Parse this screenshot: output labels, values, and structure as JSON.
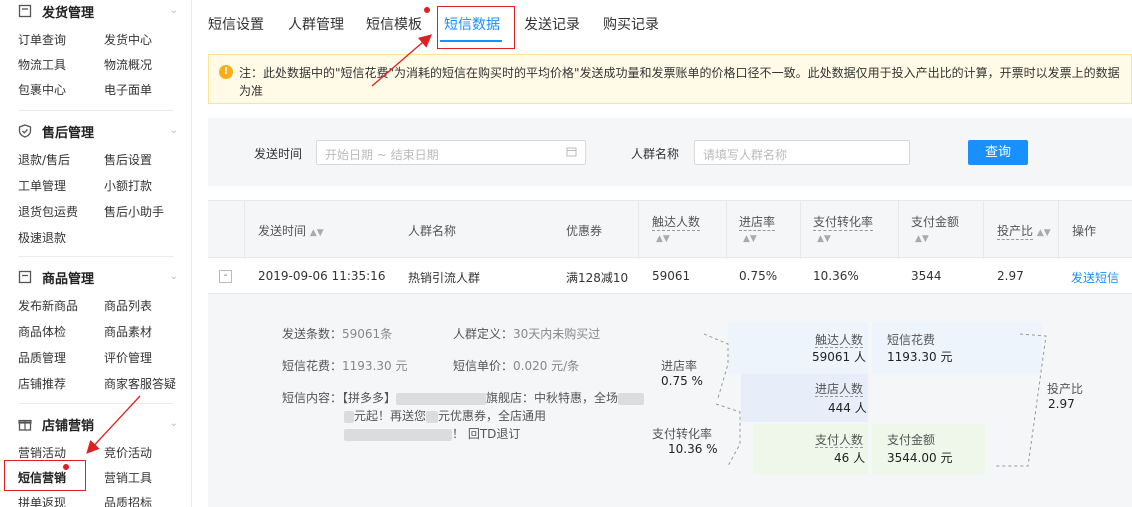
{
  "sidebar": {
    "sections": [
      {
        "title": "发货管理",
        "icon": "shipping-box-icon",
        "items": [
          "订单查询",
          "发货中心",
          "物流工具",
          "物流概况",
          "包裹中心",
          "电子面单"
        ]
      },
      {
        "title": "售后管理",
        "icon": "shield-icon",
        "items": [
          "退款/售后",
          "售后设置",
          "工单管理",
          "小额打款",
          "退货包运费",
          "售后小助手",
          "极速退款"
        ]
      },
      {
        "title": "商品管理",
        "icon": "product-box-icon",
        "items": [
          "发布新商品",
          "商品列表",
          "商品体检",
          "商品素材",
          "品质管理",
          "评价管理",
          "店铺推荐",
          "商家客服答疑"
        ]
      },
      {
        "title": "店铺营销",
        "icon": "gift-icon",
        "items": [
          "营销活动",
          "竞价活动",
          "短信营销",
          "营销工具",
          "拼单返现",
          "品质招标"
        ]
      }
    ]
  },
  "tabs": [
    "短信设置",
    "人群管理",
    "短信模板",
    "短信数据",
    "发送记录",
    "购买记录"
  ],
  "notice": "注：此处数据中的\"短信花费\"为消耗的短信在购买时的平均价格\"发送成功量和发票账单的价格口径不一致。此处数据仅用于投入产出比的计算，开票时以发票上的数据为准",
  "filter": {
    "send_time_label": "发送时间",
    "date_placeholder": "开始日期 ~ 结束日期",
    "crowd_label": "人群名称",
    "crowd_placeholder": "请填写人群名称",
    "query_button": "查询"
  },
  "table": {
    "headers": [
      "发送时间",
      "人群名称",
      "优惠券",
      "触达人数",
      "进店率",
      "支付转化率",
      "支付金额",
      "投产比",
      "操作"
    ],
    "row": {
      "expand": "-",
      "send_time": "2019-09-06 11:35:16",
      "crowd": "热销引流人群",
      "coupon": "满128减10",
      "reach": "59061",
      "visit_rate": "0.75%",
      "pay_rate": "10.36%",
      "pay_amount": "3544",
      "roi": "2.97",
      "action": "发送短信"
    }
  },
  "detail": {
    "send_count_label": "发送条数：",
    "send_count": "59061条",
    "crowd_def_label": "人群定义：",
    "crowd_def": "30天内未购买过",
    "cost_label": "短信花费：",
    "cost": "1193.30 元",
    "unit_price_label": "短信单价：",
    "unit_price": "0.020 元/条",
    "content_label": "短信内容：",
    "content_line1_a": "【拼多多】",
    "content_line1_b": "旗舰店：中秋特惠，全场",
    "content_line2_a": "元起！再送您",
    "content_line2_b": "元优惠券，全店通用",
    "content_line3": "！ 回TD退订"
  },
  "funnel": {
    "visit_rate_label": "进店率",
    "visit_rate": "0.75 %",
    "pay_rate_label": "支付转化率",
    "pay_rate": "10.36 %",
    "reach_label": "触达人数",
    "reach": "59061 人",
    "cost_label": "短信花费",
    "cost": "1193.30 元",
    "visitors_label": "进店人数",
    "visitors": "444 人",
    "payers_label": "支付人数",
    "payers": "46 人",
    "pay_amount_label": "支付金额",
    "pay_amount": "3544.00 元",
    "roi_label": "投产比",
    "roi": "2.97"
  },
  "colors": {
    "accent": "#1890ff",
    "highlight": "#e02020",
    "notice_bg": "#fffbe6"
  }
}
